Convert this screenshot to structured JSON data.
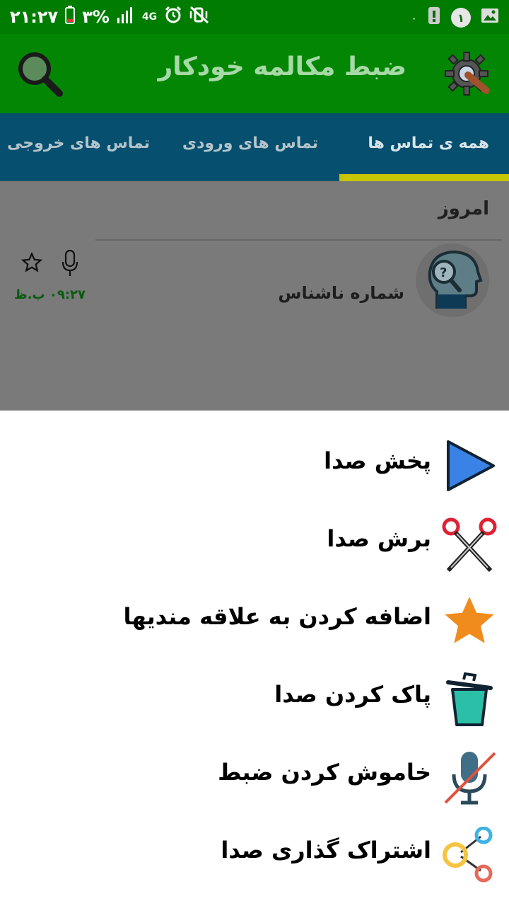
{
  "status_bar": {
    "time": "۲۱:۲۷",
    "battery": "۳%",
    "network": "4G",
    "notification_count": "۱",
    "dot": "۰"
  },
  "app_bar": {
    "title": "ضبط مکالمه خودکار"
  },
  "tabs": [
    {
      "label": "همه ی تماس ها",
      "active": true
    },
    {
      "label": "تماس های ورودی",
      "active": false
    },
    {
      "label": "تماس های خروجی",
      "active": false
    }
  ],
  "call_list": {
    "section_label": "امروز",
    "calls": [
      {
        "name": "شماره ناشناس",
        "time": "۰۹:۲۷ ب.ظ"
      }
    ]
  },
  "bottom_sheet": {
    "items": [
      {
        "label": "پخش صدا",
        "icon": "play-icon"
      },
      {
        "label": "برش صدا",
        "icon": "scissors-icon"
      },
      {
        "label": "اضافه کردن به علاقه مندیها",
        "icon": "star-icon"
      },
      {
        "label": "پاک کردن صدا",
        "icon": "trash-icon"
      },
      {
        "label": "خاموش کردن ضبط",
        "icon": "mic-off-icon"
      },
      {
        "label": "اشتراک گذاری صدا",
        "icon": "share-icon"
      }
    ]
  },
  "colors": {
    "status_bar": "#007d00",
    "app_bar": "#038603",
    "tabs_bg": "#074f6e",
    "tab_indicator": "#c7c400",
    "overlay_content": "#7a7a7a",
    "play_blue": "#3b82e6",
    "star_orange": "#f08c1e",
    "trash_teal": "#2bbfa8",
    "share_yellow": "#f5c542",
    "share_blue": "#3fb2e6",
    "share_red": "#e66a5a"
  }
}
